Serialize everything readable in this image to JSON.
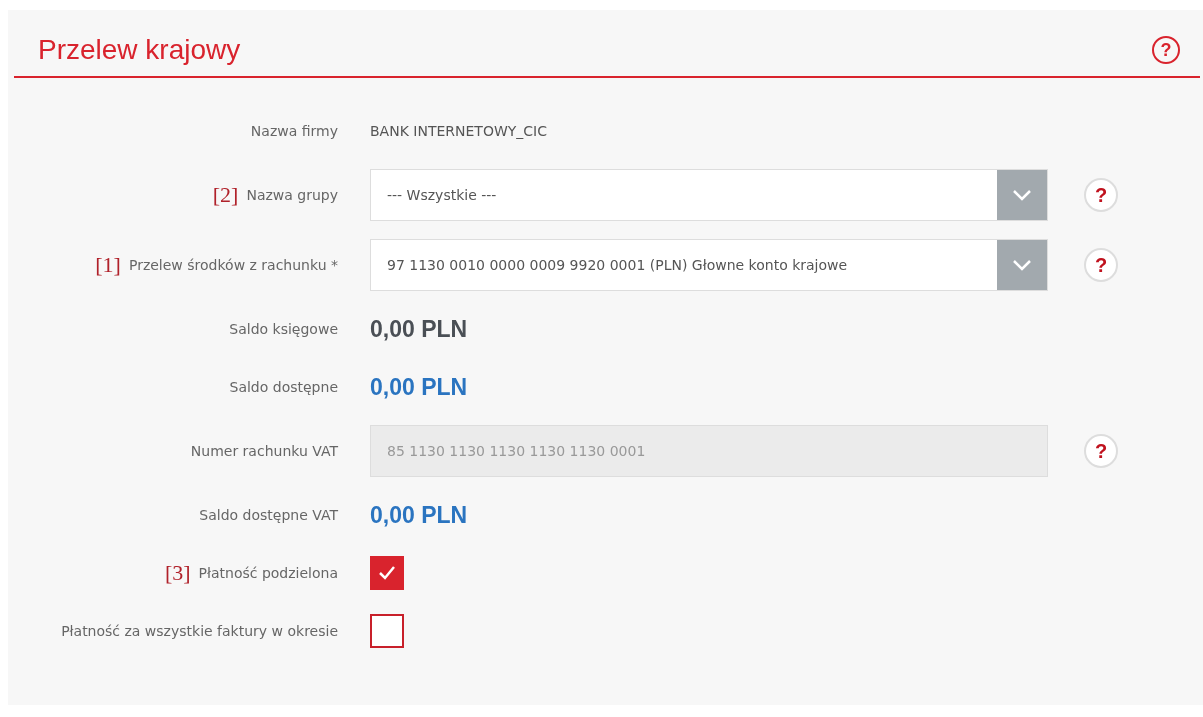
{
  "panel": {
    "title": "Przelew krajowy",
    "help": "?"
  },
  "fields": [
    {
      "kind": "text",
      "label": "Nazwa firmy",
      "value": "BANK INTERNETOWY_CIC"
    },
    {
      "kind": "select",
      "marker": "[2]",
      "label": "Nazwa grupy",
      "value": "--- Wszystkie ---",
      "help": "?"
    },
    {
      "kind": "select",
      "marker": "[1]",
      "label": "Przelew środków z rachunku *",
      "value": "97 1130 0010 0000 0009 9920 0001 (PLN) Głowne konto krajowe",
      "help": "?"
    },
    {
      "kind": "amount",
      "label": "Saldo księgowe",
      "value": "0,00 PLN",
      "color": "#4a4f55"
    },
    {
      "kind": "amount",
      "label": "Saldo dostępne",
      "value": "0,00 PLN",
      "color": "#2a74c0"
    },
    {
      "kind": "readonly",
      "label": "Numer rachunku VAT",
      "value": "85 1130 1130 1130 1130 1130 0001",
      "help": "?"
    },
    {
      "kind": "amount",
      "label": "Saldo dostępne VAT",
      "value": "0,00 PLN",
      "color": "#2a74c0"
    },
    {
      "kind": "checkbox",
      "marker": "[3]",
      "label": "Płatność podzielona",
      "checked": true
    },
    {
      "kind": "checkbox",
      "label": "Płatność za wszystkie faktury w okresie",
      "checked": false
    }
  ]
}
